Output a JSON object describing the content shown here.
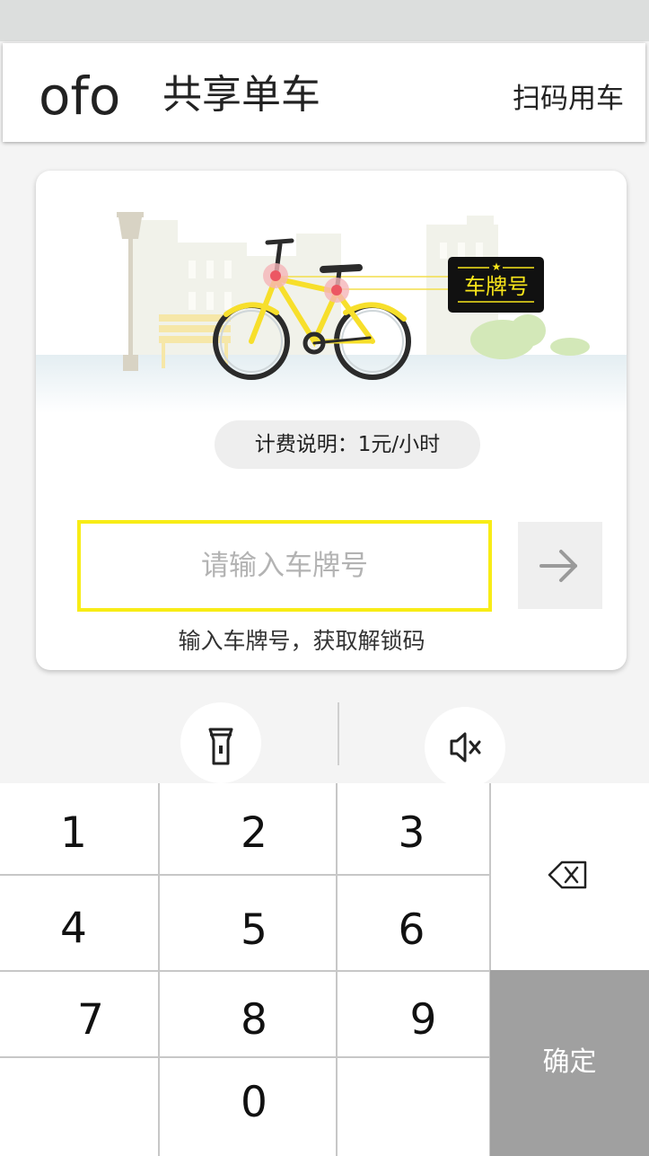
{
  "header": {
    "logo": "ofo",
    "title": "共享单车",
    "scan_label": "扫码用车"
  },
  "card": {
    "plate_badge": "车牌号",
    "fee_text": "计费说明：1元/小时",
    "input_placeholder": "请输入车牌号",
    "hint": "输入车牌号，获取解锁码"
  },
  "keypad": {
    "keys": [
      "1",
      "2",
      "3",
      "4",
      "5",
      "6",
      "7",
      "8",
      "9",
      "0"
    ],
    "confirm_label": "确定"
  },
  "colors": {
    "accent_yellow": "#f8ec16",
    "confirm_gray": "#a0a0a0"
  },
  "icons": {
    "flashlight": "flashlight-icon",
    "mute": "mute-icon",
    "arrow": "arrow-right-icon",
    "backspace": "backspace-icon"
  }
}
